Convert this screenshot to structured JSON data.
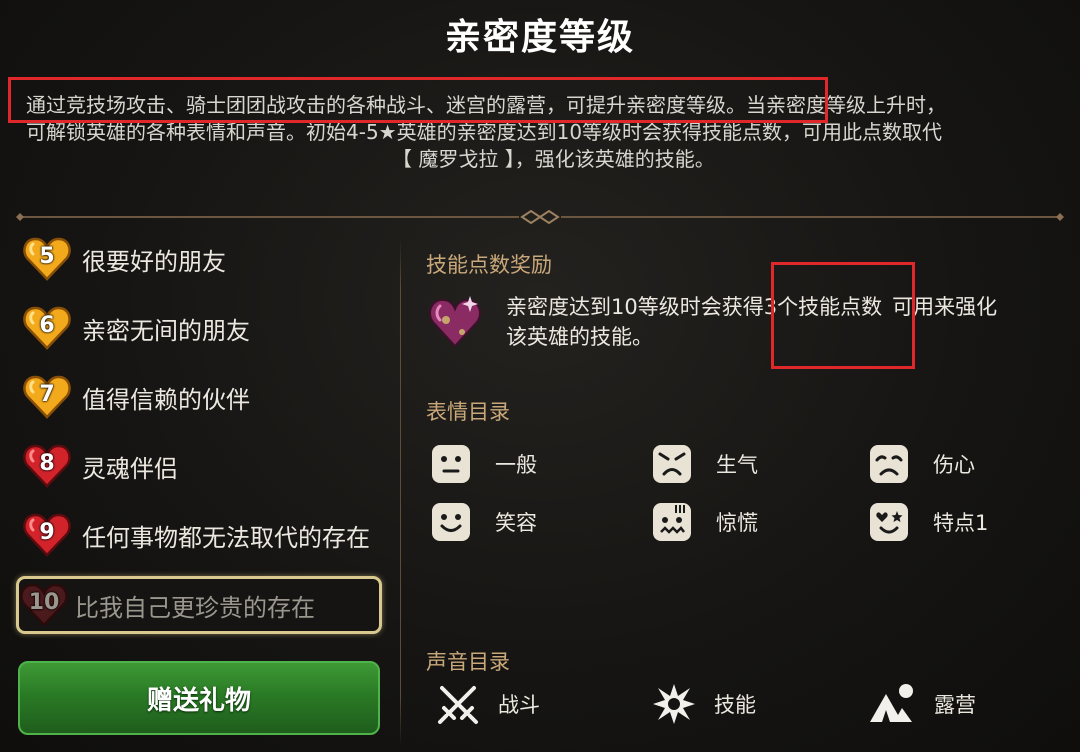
{
  "title": "亲密度等级",
  "description": {
    "line1": "通过竞技场攻击、骑士团团战攻击的各种战斗、迷宫的露营，可提升亲密度等级。当亲密度等级上升时，",
    "line2": "可解锁英雄的各种表情和声音。初始4-5★英雄的亲密度达到10等级时会获得技能点数，可用此点数取代",
    "line3": "【 魔罗戈拉 】，强化该英雄的技能。"
  },
  "levels": [
    {
      "num": "5",
      "label": "很要好的朋友"
    },
    {
      "num": "6",
      "label": "亲密无间的朋友"
    },
    {
      "num": "7",
      "label": "值得信赖的伙伴"
    },
    {
      "num": "8",
      "label": "灵魂伴侣"
    },
    {
      "num": "9",
      "label": "任何事物都无法取代的存在"
    },
    {
      "num": "10",
      "label": "比我自己更珍贵的存在"
    }
  ],
  "gift_button": "赠送礼物",
  "skill_reward": {
    "heading": "技能点数奖励",
    "text_part1": "亲密度达到10等级时会获得3个技能点数",
    "text_part2": "可用来强化",
    "text_line2": "该英雄的技能。"
  },
  "emotes": {
    "heading": "表情目录",
    "items": [
      "一般",
      "生气",
      "伤心",
      "笑容",
      "惊慌",
      "特点1"
    ]
  },
  "sounds": {
    "heading": "声音目录",
    "items": [
      "战斗",
      "技能",
      "露营"
    ]
  },
  "colors": {
    "highlight_box": "#e0282b",
    "section_heading": "#c9a87a",
    "gift_button": "#2f8a2a"
  }
}
